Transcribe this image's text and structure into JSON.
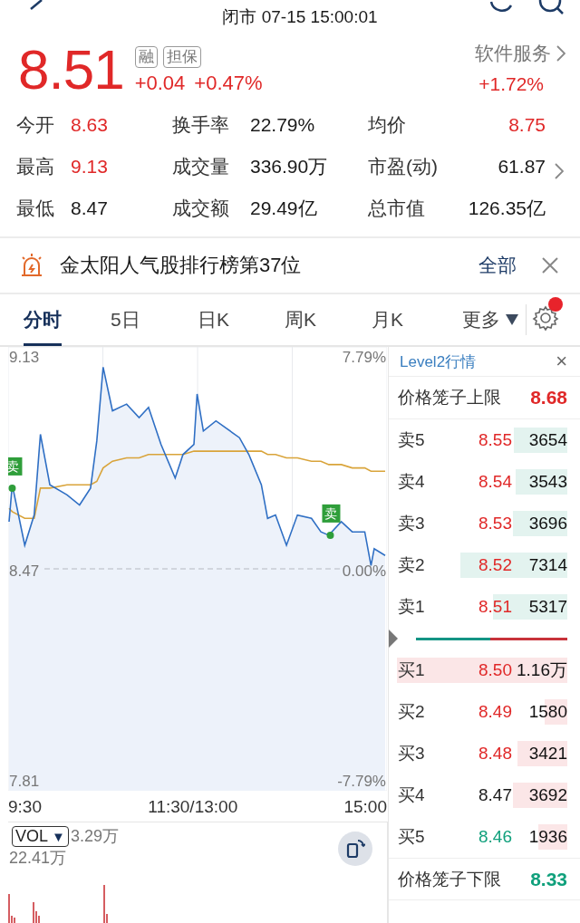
{
  "header": {
    "title": "闭市 07-15 15:00:01"
  },
  "quote": {
    "price": "8.51",
    "tags": [
      "融",
      "担保"
    ],
    "change": "+0.04",
    "change_pct": "+0.47%",
    "sector": "软件服务",
    "sector_change": "+1.72%"
  },
  "stats": [
    {
      "label": "今开",
      "value": "8.63",
      "color": "#e02828"
    },
    {
      "label": "换手率",
      "value": "22.79%",
      "color": "#1a1a1a"
    },
    {
      "label": "均价",
      "value": "8.75",
      "color": "#e02828"
    },
    {
      "label": "最高",
      "value": "9.13",
      "color": "#e02828"
    },
    {
      "label": "成交量",
      "value": "336.90万",
      "color": "#1a1a1a"
    },
    {
      "label": "市盈(动)",
      "value": "61.87",
      "color": "#1a1a1a"
    },
    {
      "label": "最低",
      "value": "8.47",
      "color": "#1a1a1a"
    },
    {
      "label": "成交额",
      "value": "29.49亿",
      "color": "#1a1a1a"
    },
    {
      "label": "总市值",
      "value": "126.35亿",
      "color": "#1a1a1a"
    }
  ],
  "banner": {
    "text": "金太阳人气股排行榜第37位",
    "action": "全部"
  },
  "tabs": [
    {
      "label": "分时",
      "selected": true
    },
    {
      "label": "5日",
      "selected": false
    },
    {
      "label": "日K",
      "selected": false
    },
    {
      "label": "周K",
      "selected": false
    },
    {
      "label": "月K",
      "selected": false
    },
    {
      "label": "更多",
      "selected": false,
      "kind": "dropdown"
    }
  ],
  "settings": {
    "badge": true
  },
  "intraday": {
    "left_labels": [
      "9.13",
      "8.47",
      "7.81"
    ],
    "right_labels": [
      "7.79%",
      "0.00%",
      "-7.79%"
    ],
    "time_labels": [
      "9:30",
      "11:30/13:00",
      "15:00"
    ],
    "markers": [
      "卖",
      "卖"
    ]
  },
  "volume": {
    "indicator": "VOL",
    "indicator_caret": "▼",
    "current": "3.29万",
    "max": "22.41万"
  },
  "level2": {
    "title": "Level2行情",
    "close": "×",
    "upper": {
      "label": "价格笼子上限",
      "value": "8.68",
      "color": "#e02828"
    },
    "asks": [
      {
        "label": "卖5",
        "price": "8.55",
        "volume": "3654",
        "color": "#e02828"
      },
      {
        "label": "卖4",
        "price": "8.54",
        "volume": "3543",
        "color": "#e02828"
      },
      {
        "label": "卖3",
        "price": "8.53",
        "volume": "3696",
        "color": "#e02828"
      },
      {
        "label": "卖2",
        "price": "8.52",
        "volume": "7314",
        "color": "#e02828"
      },
      {
        "label": "卖1",
        "price": "8.51",
        "volume": "5317",
        "color": "#e02828"
      }
    ],
    "ratio": {
      "level": 0.49
    },
    "bids": [
      {
        "label": "买1",
        "price": "8.50",
        "volume": "1.16万",
        "color": "#e02828"
      },
      {
        "label": "买2",
        "price": "8.49",
        "volume": "1580",
        "color": "#e02828"
      },
      {
        "label": "买3",
        "price": "8.48",
        "volume": "3421",
        "color": "#e02828"
      },
      {
        "label": "买4",
        "price": "8.47",
        "volume": "3692",
        "color": "#1a1a1a"
      },
      {
        "label": "买5",
        "price": "8.46",
        "volume": "1936",
        "color": "#10a07c"
      }
    ],
    "lower": {
      "label": "价格笼子下限",
      "value": "8.33",
      "color": "#10a07c"
    }
  }
}
